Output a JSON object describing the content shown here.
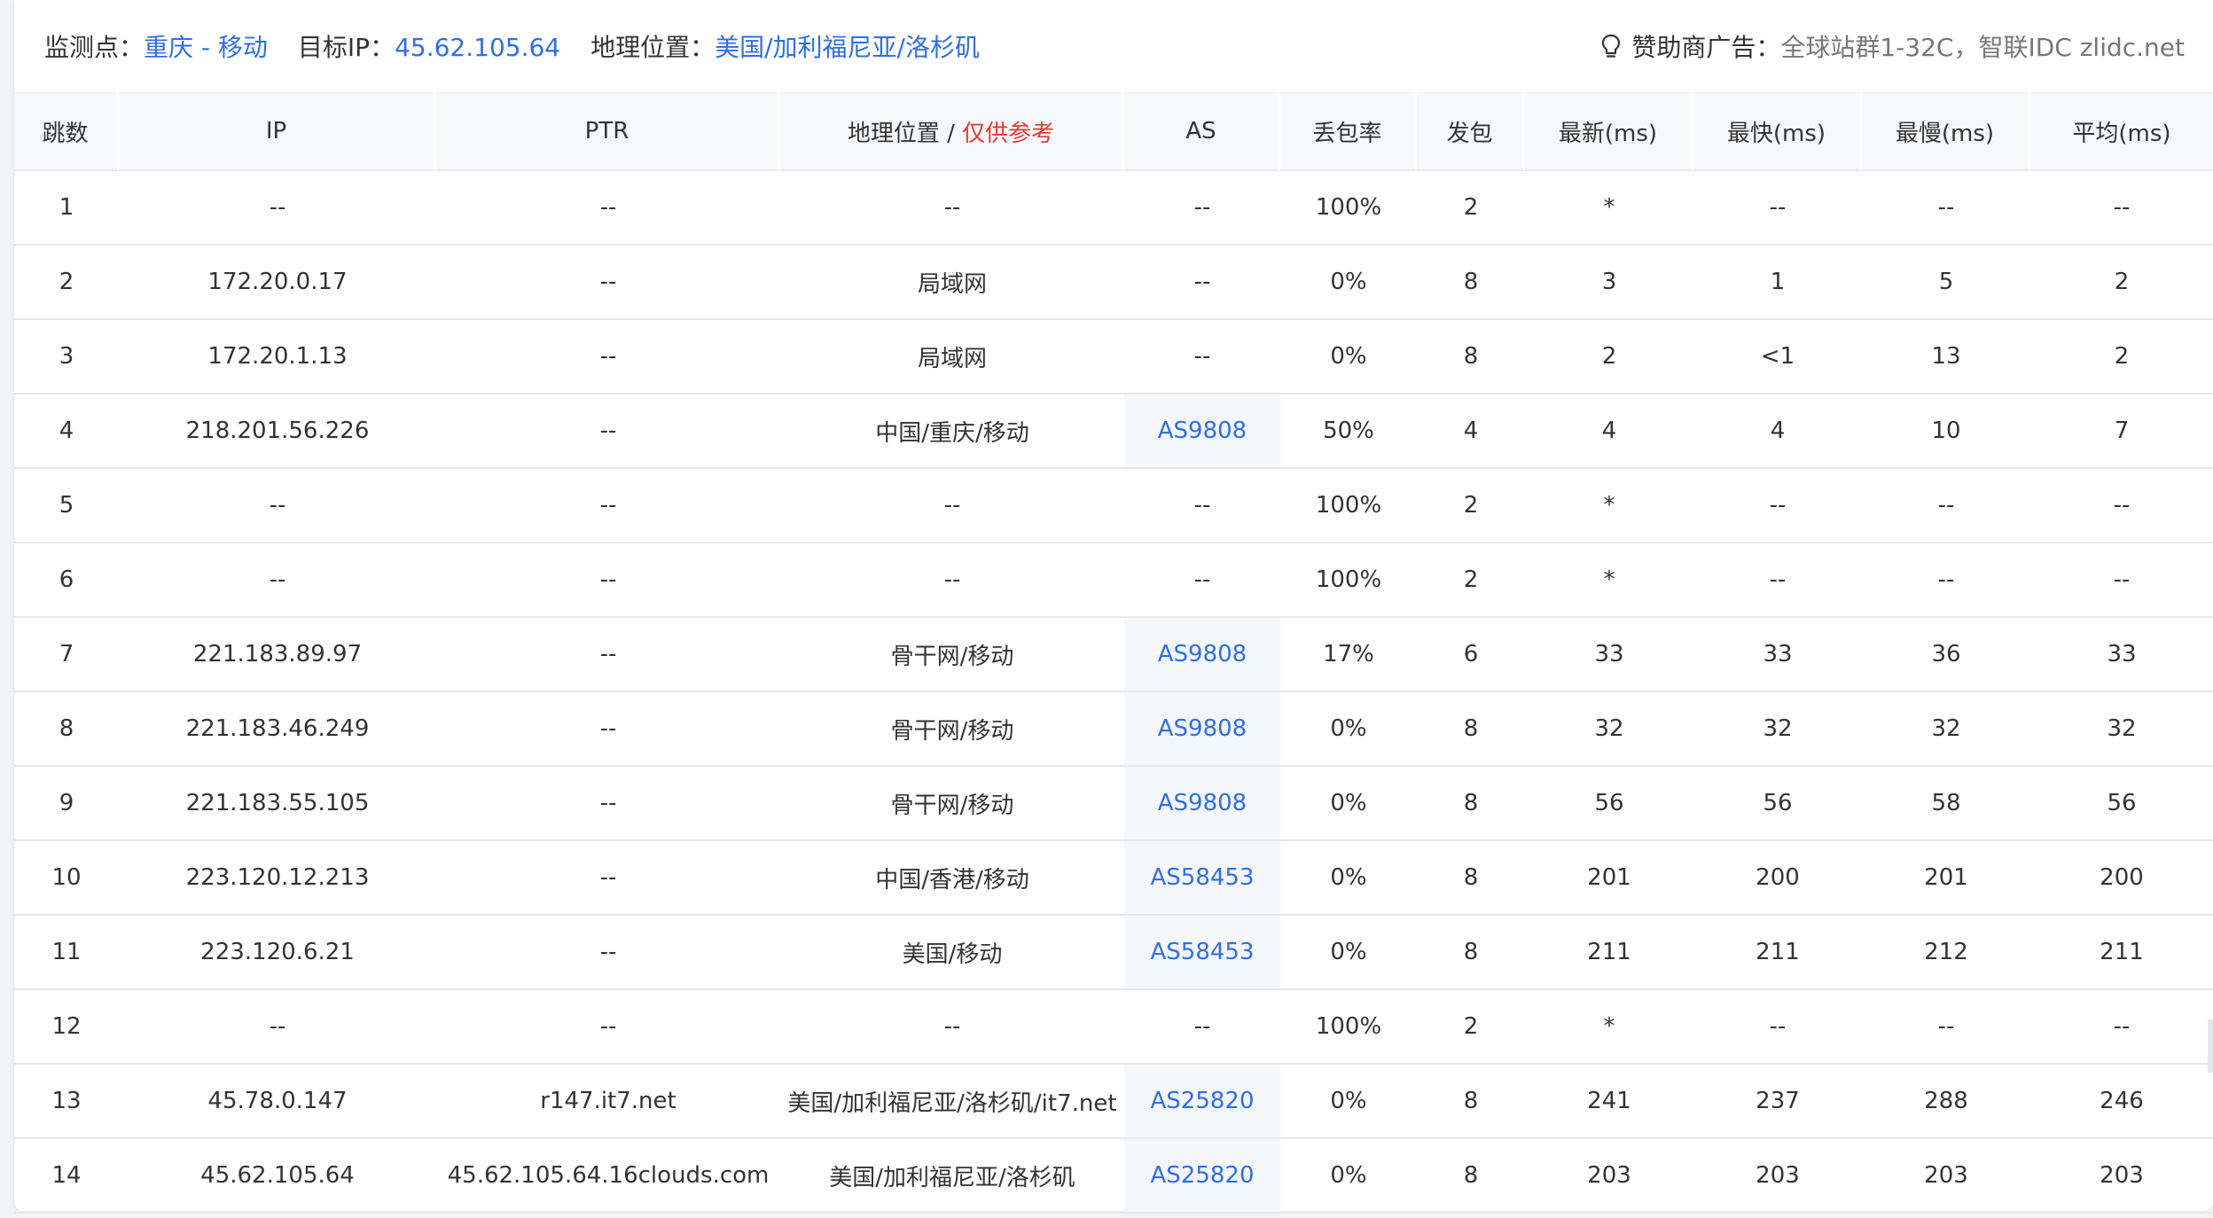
{
  "info": {
    "monitor_label": "监测点：",
    "monitor_value": "重庆 - 移动",
    "target_label": "目标IP：",
    "target_value": "45.62.105.64",
    "geo_label": "地理位置：",
    "geo_value": "美国/加利福尼亚/洛杉矶",
    "sponsor_icon": "bulb-icon",
    "sponsor_label": "赞助商广告：",
    "sponsor_text": "全球站群1-32C，智联IDC zlidc.net"
  },
  "colors": {
    "link": "#2f6ee8",
    "note": "#e53935",
    "header_bg": "#f7f8fa",
    "as_cell_bg": "#f5f7fb"
  },
  "table": {
    "headers": {
      "hop": "跳数",
      "ip": "IP",
      "ptr": "PTR",
      "geo": "地理位置 / ",
      "geo_note": "仅供参考",
      "as": "AS",
      "loss": "丢包率",
      "sent": "发包",
      "last": "最新(ms)",
      "best": "最快(ms)",
      "worst": "最慢(ms)",
      "avg": "平均(ms)"
    },
    "rows": [
      {
        "hop": "1",
        "ip": "--",
        "ptr": "--",
        "geo": "--",
        "as": "--",
        "loss": "100%",
        "sent": "2",
        "last": "*",
        "best": "--",
        "worst": "--",
        "avg": "--"
      },
      {
        "hop": "2",
        "ip": "172.20.0.17",
        "ptr": "--",
        "geo": "局域网",
        "as": "--",
        "loss": "0%",
        "sent": "8",
        "last": "3",
        "best": "1",
        "worst": "5",
        "avg": "2"
      },
      {
        "hop": "3",
        "ip": "172.20.1.13",
        "ptr": "--",
        "geo": "局域网",
        "as": "--",
        "loss": "0%",
        "sent": "8",
        "last": "2",
        "best": "<1",
        "worst": "13",
        "avg": "2"
      },
      {
        "hop": "4",
        "ip": "218.201.56.226",
        "ptr": "--",
        "geo": "中国/重庆/移动",
        "as": "AS9808",
        "loss": "50%",
        "sent": "4",
        "last": "4",
        "best": "4",
        "worst": "10",
        "avg": "7"
      },
      {
        "hop": "5",
        "ip": "--",
        "ptr": "--",
        "geo": "--",
        "as": "--",
        "loss": "100%",
        "sent": "2",
        "last": "*",
        "best": "--",
        "worst": "--",
        "avg": "--"
      },
      {
        "hop": "6",
        "ip": "--",
        "ptr": "--",
        "geo": "--",
        "as": "--",
        "loss": "100%",
        "sent": "2",
        "last": "*",
        "best": "--",
        "worst": "--",
        "avg": "--"
      },
      {
        "hop": "7",
        "ip": "221.183.89.97",
        "ptr": "--",
        "geo": "骨干网/移动",
        "as": "AS9808",
        "loss": "17%",
        "sent": "6",
        "last": "33",
        "best": "33",
        "worst": "36",
        "avg": "33"
      },
      {
        "hop": "8",
        "ip": "221.183.46.249",
        "ptr": "--",
        "geo": "骨干网/移动",
        "as": "AS9808",
        "loss": "0%",
        "sent": "8",
        "last": "32",
        "best": "32",
        "worst": "32",
        "avg": "32"
      },
      {
        "hop": "9",
        "ip": "221.183.55.105",
        "ptr": "--",
        "geo": "骨干网/移动",
        "as": "AS9808",
        "loss": "0%",
        "sent": "8",
        "last": "56",
        "best": "56",
        "worst": "58",
        "avg": "56"
      },
      {
        "hop": "10",
        "ip": "223.120.12.213",
        "ptr": "--",
        "geo": "中国/香港/移动",
        "as": "AS58453",
        "loss": "0%",
        "sent": "8",
        "last": "201",
        "best": "200",
        "worst": "201",
        "avg": "200"
      },
      {
        "hop": "11",
        "ip": "223.120.6.21",
        "ptr": "--",
        "geo": "美国/移动",
        "as": "AS58453",
        "loss": "0%",
        "sent": "8",
        "last": "211",
        "best": "211",
        "worst": "212",
        "avg": "211"
      },
      {
        "hop": "12",
        "ip": "--",
        "ptr": "--",
        "geo": "--",
        "as": "--",
        "loss": "100%",
        "sent": "2",
        "last": "*",
        "best": "--",
        "worst": "--",
        "avg": "--"
      },
      {
        "hop": "13",
        "ip": "45.78.0.147",
        "ptr": "r147.it7.net",
        "geo": "美国/加利福尼亚/洛杉矶/it7.net",
        "as": "AS25820",
        "loss": "0%",
        "sent": "8",
        "last": "241",
        "best": "237",
        "worst": "288",
        "avg": "246"
      },
      {
        "hop": "14",
        "ip": "45.62.105.64",
        "ptr": "45.62.105.64.16clouds.com",
        "geo": "美国/加利福尼亚/洛杉矶",
        "as": "AS25820",
        "loss": "0%",
        "sent": "8",
        "last": "203",
        "best": "203",
        "worst": "203",
        "avg": "203"
      }
    ]
  }
}
